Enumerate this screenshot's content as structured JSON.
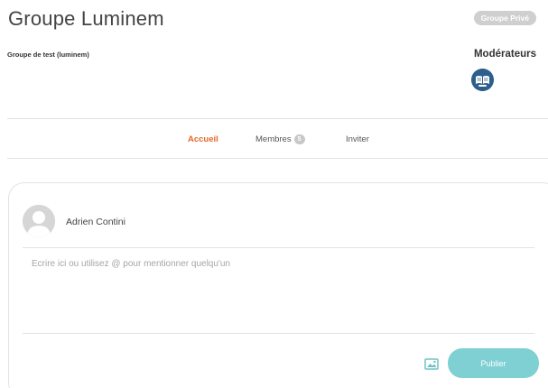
{
  "group": {
    "title": "Groupe Luminem",
    "privacy_badge": "Groupe Privé",
    "description": "Groupe de test (luminem)"
  },
  "moderators": {
    "title": "Modérateurs",
    "avatar_icon": "moderator-avatar-icon"
  },
  "tabs": [
    {
      "label": "Accueil",
      "active": true
    },
    {
      "label": "Membres",
      "count": "5"
    },
    {
      "label": "Inviter"
    }
  ],
  "composer": {
    "author_name": "Adrien Contini",
    "placeholder": "Ecrire ici ou utilisez @ pour mentionner quelqu'un",
    "media_icon": "image-upload-icon",
    "publish_label": "Publier"
  },
  "colors": {
    "accent": "#e06a2a",
    "publish": "#7fd0d3",
    "badge": "#cfcfcf",
    "moderator_avatar": "#2e5f8c"
  }
}
